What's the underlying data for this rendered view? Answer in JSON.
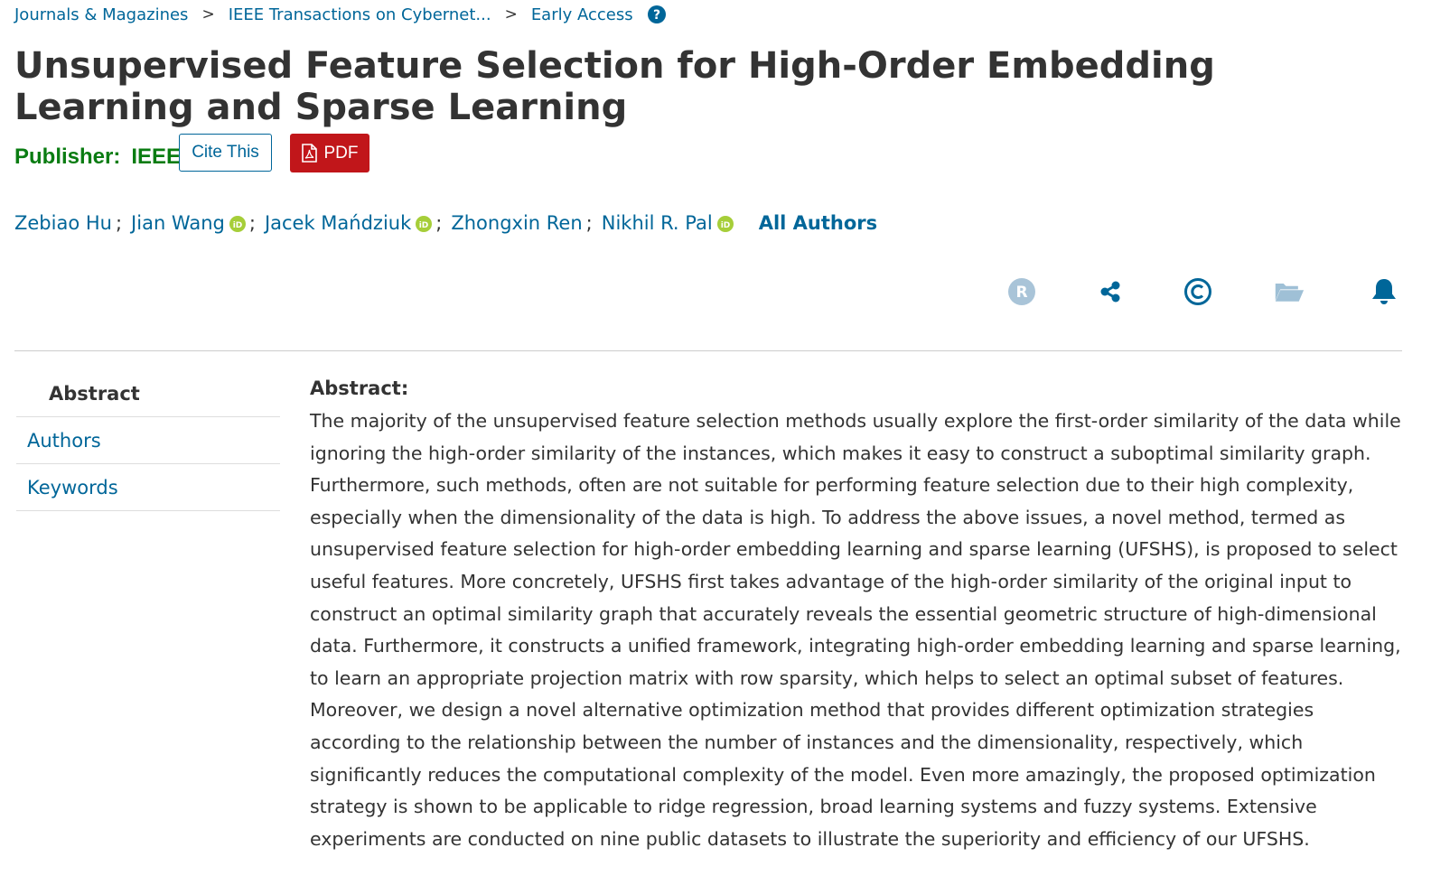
{
  "breadcrumb": {
    "items": [
      "Journals & Magazines",
      "IEEE Transactions on Cybernet...",
      "Early Access"
    ],
    "separator": ">"
  },
  "title": "Unsupervised Feature Selection for High-Order Embedding Learning and Sparse Learning",
  "publisher": {
    "label": "Publisher:",
    "name": "IEEE"
  },
  "buttons": {
    "cite": "Cite This",
    "pdf": "PDF"
  },
  "authors": {
    "list": [
      {
        "name": "Zebiao Hu",
        "orcid": false
      },
      {
        "name": "Jian Wang",
        "orcid": true
      },
      {
        "name": "Jacek Mańdziuk",
        "orcid": true
      },
      {
        "name": "Zhongxin Ren",
        "orcid": false
      },
      {
        "name": "Nikhil R. Pal",
        "orcid": true
      }
    ],
    "separator": ";",
    "all_authors": "All Authors"
  },
  "actions": [
    "rights-icon",
    "share-icon",
    "copyright-icon",
    "folder-icon",
    "alert-bell-icon"
  ],
  "nav": {
    "items": [
      "Abstract",
      "Authors",
      "Keywords"
    ],
    "active": "Abstract"
  },
  "abstract": {
    "heading": "Abstract:",
    "text": "The majority of the unsupervised feature selection methods usually explore the first-order similarity of the data while ignoring the high-order similarity of the instances, which makes it easy to construct a suboptimal similarity graph. Furthermore, such methods, often are not suitable for performing feature selection due to their high complexity, especially when the dimensionality of the data is high. To address the above issues, a novel method, termed as unsupervised feature selection for high-order embedding learning and sparse learning (UFSHS), is proposed to select useful features. More concretely, UFSHS first takes advantage of the high-order similarity of the original input to construct an optimal similarity graph that accurately reveals the essential geometric structure of high-dimensional data. Furthermore, it constructs a unified framework, integrating high-order embedding learning and sparse learning, to learn an appropriate projection matrix with row sparsity, which helps to select an optimal subset of features. Moreover, we design a novel alternative optimization method that provides different optimization strategies according to the relationship between the number of instances and the dimensionality, respectively, which significantly reduces the computational complexity of the model. Even more amazingly, the proposed optimization strategy is shown to be applicable to ridge regression, broad learning systems and fuzzy systems. Extensive experiments are conducted on nine public datasets to illustrate the superiority and efficiency of our UFSHS."
  },
  "colors": {
    "link": "#006699",
    "publisher": "#0a7c12",
    "pdf": "#c1161a",
    "text": "#333333",
    "orcid": "#a6ce39"
  }
}
